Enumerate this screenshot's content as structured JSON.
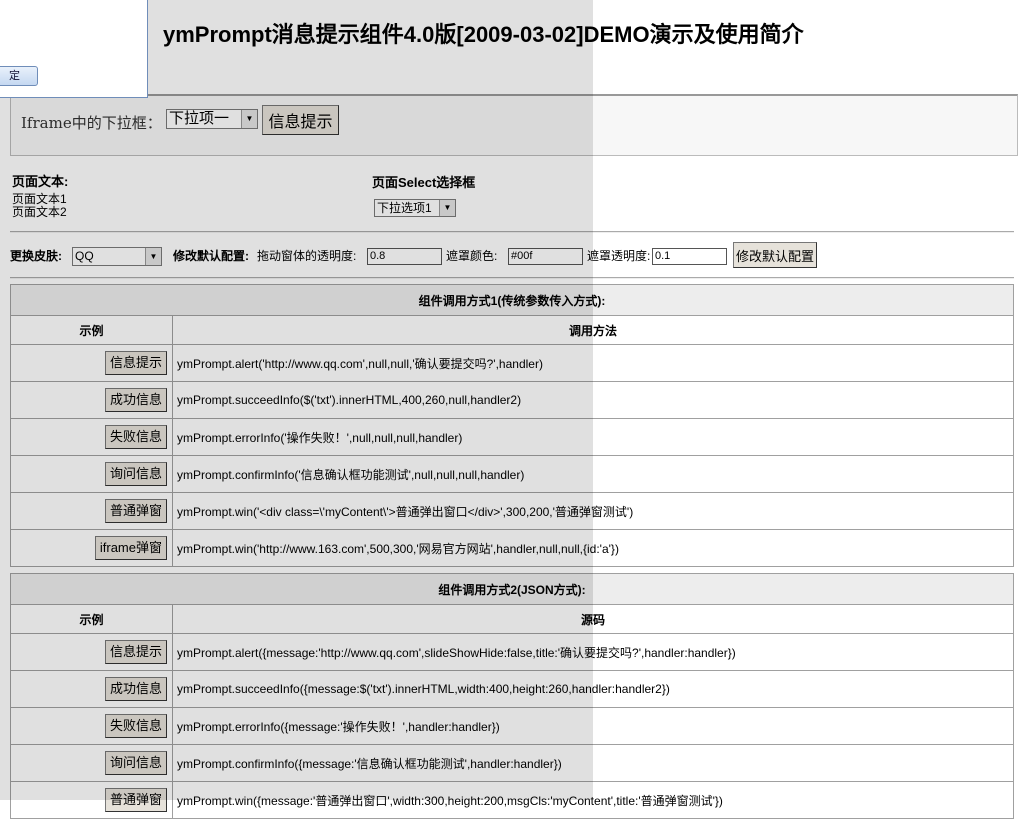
{
  "popup": {
    "button_label": "定"
  },
  "title": "ymPrompt消息提示组件4.0版[2009-03-02]DEMO演示及使用简介",
  "iframe": {
    "label": "Iframe中的下拉框：",
    "select_value": "下拉项一",
    "button": "信息提示"
  },
  "page_text": {
    "heading": "页面文本:",
    "line1": "页面文本1",
    "line2": "页面文本2"
  },
  "page_select": {
    "heading": "页面Select选择框",
    "value": "下拉选项1"
  },
  "config": {
    "skin_label": "更换皮肤:",
    "skin_value": "QQ",
    "modify_label": "修改默认配置:",
    "opacity_label": "拖动窗体的透明度:",
    "opacity_value": "0.8",
    "mask_color_label": "遮罩颜色:",
    "mask_color_value": "#00f",
    "mask_opacity_label": "遮罩透明度:",
    "mask_opacity_value": "0.1",
    "modify_button": "修改默认配置"
  },
  "table1": {
    "caption": "组件调用方式1(传统参数传入方式):",
    "col1": "示例",
    "col2": "调用方法",
    "rows": [
      {
        "btn": "信息提示",
        "code": "ymPrompt.alert('http://www.qq.com',null,null,'确认要提交吗?',handler)"
      },
      {
        "btn": "成功信息",
        "code": "ymPrompt.succeedInfo($('txt').innerHTML,400,260,null,handler2)"
      },
      {
        "btn": "失败信息",
        "code": "ymPrompt.errorInfo('操作失败！',null,null,null,handler)"
      },
      {
        "btn": "询问信息",
        "code": "ymPrompt.confirmInfo('信息确认框功能测试',null,null,null,handler)"
      },
      {
        "btn": "普通弹窗",
        "code": "ymPrompt.win('<div class=\\'myContent\\'>普通弹出窗口</div>',300,200,'普通弹窗测试')"
      },
      {
        "btn": "iframe弹窗",
        "code": "ymPrompt.win('http://www.163.com',500,300,'网易官方网站',handler,null,null,{id:'a'})"
      }
    ]
  },
  "table2": {
    "caption": "组件调用方式2(JSON方式):",
    "col1": "示例",
    "col2": "源码",
    "rows": [
      {
        "btn": "信息提示",
        "code": "ymPrompt.alert({message:'http://www.qq.com',slideShowHide:false,title:'确认要提交吗?',handler:handler})"
      },
      {
        "btn": "成功信息",
        "code": "ymPrompt.succeedInfo({message:$('txt').innerHTML,width:400,height:260,handler:handler2})"
      },
      {
        "btn": "失败信息",
        "code": "ymPrompt.errorInfo({message:'操作失败！',handler:handler})"
      },
      {
        "btn": "询问信息",
        "code": "ymPrompt.confirmInfo({message:'信息确认框功能测试',handler:handler})"
      },
      {
        "btn": "普通弹窗",
        "code": "ymPrompt.win({message:'普通弹出窗口',width:300,height:200,msgCls:'myContent',title:'普通弹窗测试'})"
      }
    ]
  }
}
